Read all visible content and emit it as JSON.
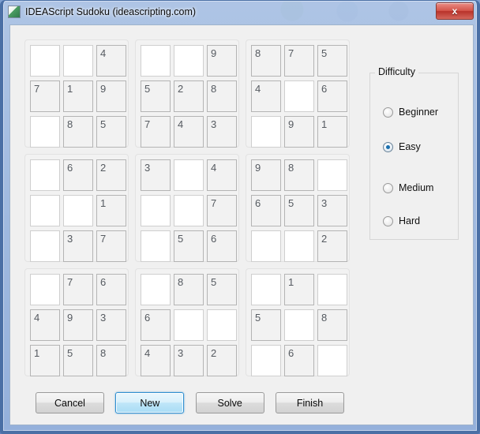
{
  "window": {
    "title": "IDEAScript Sudoku (ideascripting.com)",
    "app_icon": "app-icon",
    "close_label": "x",
    "border_color": "#4a6fa5",
    "close_color": "#b8322a"
  },
  "sudoku": {
    "blocks": [
      {
        "name": "block-top-left",
        "cells": [
          "",
          "",
          "4",
          "7",
          "1",
          "9",
          "",
          "8",
          "5"
        ]
      },
      {
        "name": "block-top-center",
        "cells": [
          "",
          "",
          "9",
          "5",
          "2",
          "8",
          "7",
          "4",
          "3"
        ]
      },
      {
        "name": "block-top-right",
        "cells": [
          "8",
          "7",
          "5",
          "4",
          "",
          "6",
          "",
          "9",
          "1"
        ]
      },
      {
        "name": "block-middle-left",
        "cells": [
          "",
          "6",
          "2",
          "",
          "",
          "1",
          "",
          "3",
          "7"
        ]
      },
      {
        "name": "block-middle-center",
        "cells": [
          "3",
          "",
          "4",
          "",
          "",
          "7",
          "",
          "5",
          "6"
        ]
      },
      {
        "name": "block-middle-right",
        "cells": [
          "9",
          "8",
          "",
          "6",
          "5",
          "3",
          "",
          "",
          "2"
        ]
      },
      {
        "name": "block-bottom-left",
        "cells": [
          "",
          "7",
          "6",
          "4",
          "9",
          "3",
          "1",
          "5",
          "8"
        ]
      },
      {
        "name": "block-bottom-center",
        "cells": [
          "",
          "8",
          "5",
          "6",
          "",
          "",
          "4",
          "3",
          "2"
        ]
      },
      {
        "name": "block-bottom-right",
        "cells": [
          "",
          "1",
          "",
          "5",
          "",
          "8",
          "",
          "6",
          ""
        ]
      }
    ]
  },
  "difficulty": {
    "legend": "Difficulty",
    "selected": "Easy",
    "accent_color": "#1a6fae",
    "options": [
      {
        "label": "Beginner",
        "selected": false
      },
      {
        "label": "Easy",
        "selected": true
      },
      {
        "label": "Medium",
        "selected": false
      },
      {
        "label": "Hard",
        "selected": false
      }
    ]
  },
  "buttons": [
    {
      "label": "Cancel",
      "name": "cancel-button",
      "focused": false
    },
    {
      "label": "New",
      "name": "new-button",
      "focused": true
    },
    {
      "label": "Solve",
      "name": "solve-button",
      "focused": false
    },
    {
      "label": "Finish",
      "name": "finish-button",
      "focused": false
    }
  ]
}
